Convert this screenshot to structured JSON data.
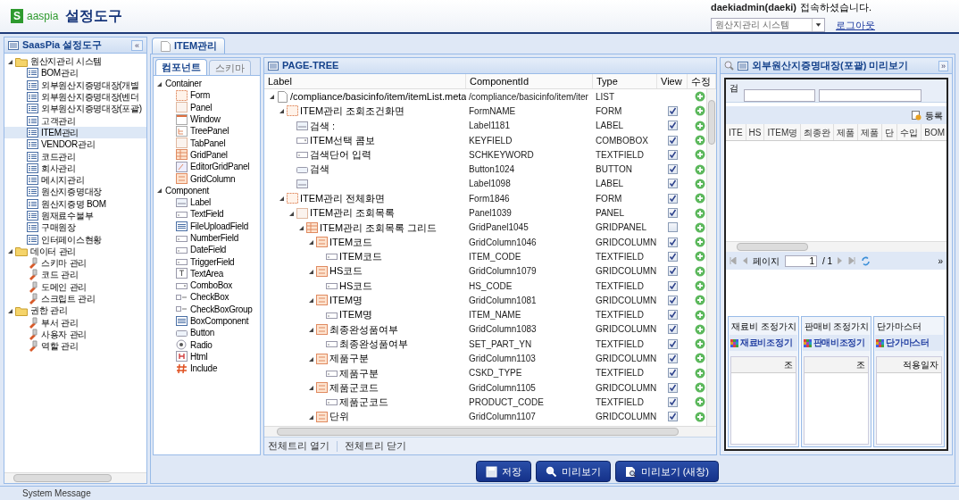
{
  "header": {
    "logo_mark": "S",
    "logo_text": "aaspia",
    "title": "설정도구",
    "user_name": "daekiadmin(daeki)",
    "user_suffix": "접속하셨습니다.",
    "system_select": "원산지관리 시스템",
    "logout": "로그아웃"
  },
  "sidebar": {
    "title": "SaasPia 설정도구",
    "collapse": "«",
    "tree": [
      {
        "label": "원산지관리 시스템",
        "kind": "folder",
        "expanded": true,
        "children": [
          {
            "label": "BOM관리",
            "kind": "page",
            "selected": false
          },
          {
            "label": "외부원산지증명대장(개별",
            "kind": "page",
            "selected": false
          },
          {
            "label": "외부원산지증명대장(벤더",
            "kind": "page",
            "selected": false
          },
          {
            "label": "외부원산지증명대장(포괄)",
            "kind": "page",
            "selected": false
          },
          {
            "label": "고객관리",
            "kind": "page",
            "selected": false
          },
          {
            "label": "ITEM관리",
            "kind": "page",
            "selected": true
          },
          {
            "label": "VENDOR관리",
            "kind": "page",
            "selected": false
          },
          {
            "label": "코드관리",
            "kind": "page",
            "selected": false
          },
          {
            "label": "회사관리",
            "kind": "page",
            "selected": false
          },
          {
            "label": "메시지관리",
            "kind": "page",
            "selected": false
          },
          {
            "label": "원산지증명대장",
            "kind": "page",
            "selected": false
          },
          {
            "label": "원산지증명 BOM",
            "kind": "page",
            "selected": false
          },
          {
            "label": "원재료수불부",
            "kind": "page",
            "selected": false
          },
          {
            "label": "구매원장",
            "kind": "page",
            "selected": false
          },
          {
            "label": "인터페이스현황",
            "kind": "page",
            "selected": false
          }
        ]
      },
      {
        "label": "데이터 관리",
        "kind": "folder",
        "expanded": true,
        "children": [
          {
            "label": "스키마 관리",
            "kind": "tool",
            "selected": false
          },
          {
            "label": "코드 관리",
            "kind": "tool",
            "selected": false
          },
          {
            "label": "도메인 관리",
            "kind": "tool",
            "selected": false
          },
          {
            "label": "스크립트 관리",
            "kind": "tool",
            "selected": false
          }
        ]
      },
      {
        "label": "권한 관리",
        "kind": "folder",
        "expanded": true,
        "children": [
          {
            "label": "부서 관리",
            "kind": "tool",
            "selected": false
          },
          {
            "label": "사용자 관리",
            "kind": "tool",
            "selected": false
          },
          {
            "label": "역할 관리",
            "kind": "tool",
            "selected": false
          }
        ]
      }
    ]
  },
  "tabs": [
    {
      "label": "ITEM관리",
      "selected": true
    }
  ],
  "palette": {
    "tabs": [
      {
        "label": "컴포넌트",
        "selected": true
      },
      {
        "label": "스키마",
        "selected": false
      }
    ],
    "groups": [
      {
        "label": "Container",
        "expanded": true,
        "children": [
          {
            "label": "Form",
            "kind": "form"
          },
          {
            "label": "Panel",
            "kind": "panel"
          },
          {
            "label": "Window",
            "kind": "window"
          },
          {
            "label": "TreePanel",
            "kind": "tree"
          },
          {
            "label": "TabPanel",
            "kind": "panel"
          },
          {
            "label": "GridPanel",
            "kind": "grid"
          },
          {
            "label": "EditorGridPanel",
            "kind": "editor"
          },
          {
            "label": "GridColumn",
            "kind": "column"
          }
        ]
      },
      {
        "label": "Component",
        "expanded": true,
        "children": [
          {
            "label": "Label",
            "kind": "label"
          },
          {
            "label": "TextField",
            "kind": "textfield"
          },
          {
            "label": "FileUploadField",
            "kind": "list"
          },
          {
            "label": "NumberField",
            "kind": "textfield"
          },
          {
            "label": "DateField",
            "kind": "textfield"
          },
          {
            "label": "TriggerField",
            "kind": "textfield"
          },
          {
            "label": "TextArea",
            "kind": "textarea"
          },
          {
            "label": "ComboBox",
            "kind": "combo"
          },
          {
            "label": "CheckBox",
            "kind": "checkbox"
          },
          {
            "label": "CheckBoxGroup",
            "kind": "checkbox"
          },
          {
            "label": "BoxComponent",
            "kind": "list"
          },
          {
            "label": "Button",
            "kind": "button"
          },
          {
            "label": "Radio",
            "kind": "radio"
          },
          {
            "label": "Html",
            "kind": "html"
          },
          {
            "label": "Include",
            "kind": "include"
          }
        ]
      }
    ]
  },
  "page_tree": {
    "title": "PAGE-TREE",
    "columns": [
      "Label",
      "ComponentId",
      "Type",
      "View",
      "수정"
    ],
    "rows": [
      {
        "label": "/compliance/basicinfo/item/itemList.meta",
        "component_id": "/compliance/basicinfo/item/iter",
        "type": "LIST",
        "kind": "file",
        "expanded": true,
        "children": [
          {
            "label": "ITEM관리 조회조건화면",
            "component_id": "FormNAME",
            "type": "FORM",
            "kind": "form",
            "view": true,
            "expanded": true,
            "children": [
              {
                "label": "검색 :",
                "component_id": "Label1181",
                "type": "LABEL",
                "kind": "label",
                "view": true
              },
              {
                "label": "ITEM선택 콤보",
                "component_id": "KEYFIELD",
                "type": "COMBOBOX",
                "kind": "combo",
                "view": true
              },
              {
                "label": "검색단어 입력",
                "component_id": "SCHKEYWORD",
                "type": "TEXTFIELD",
                "kind": "textfield",
                "view": true
              },
              {
                "label": "검색",
                "component_id": "Button1024",
                "type": "BUTTON",
                "kind": "button",
                "view": true
              },
              {
                "component_id": "Label1098",
                "type": "LABEL",
                "kind": "label",
                "view": true
              }
            ]
          },
          {
            "label": "ITEM관리 전체화면",
            "component_id": "Form1846",
            "type": "FORM",
            "kind": "form",
            "view": true,
            "expanded": true,
            "children": [
              {
                "label": "ITEM관리 조회목록",
                "component_id": "Panel1039",
                "type": "PANEL",
                "kind": "panel",
                "view": true,
                "expanded": true,
                "children": [
                  {
                    "label": "ITEM관리 조회목록 그리드",
                    "component_id": "GridPanel1045",
                    "type": "GRIDPANEL",
                    "kind": "grid",
                    "view": false,
                    "expanded": true,
                    "children": [
                      {
                        "label": "ITEM코드",
                        "component_id": "GridColumn1046",
                        "type": "GRIDCOLUMN",
                        "kind": "column",
                        "view": true,
                        "expanded": true,
                        "children": [
                          {
                            "label": "ITEM코드",
                            "component_id": "ITEM_CODE",
                            "type": "TEXTFIELD",
                            "kind": "textfield",
                            "view": true
                          }
                        ]
                      },
                      {
                        "label": "HS코드",
                        "component_id": "GridColumn1079",
                        "type": "GRIDCOLUMN",
                        "kind": "column",
                        "view": true,
                        "expanded": true,
                        "children": [
                          {
                            "label": "HS코드",
                            "component_id": "HS_CODE",
                            "type": "TEXTFIELD",
                            "kind": "textfield",
                            "view": true
                          }
                        ]
                      },
                      {
                        "label": "ITEM명",
                        "component_id": "GridColumn1081",
                        "type": "GRIDCOLUMN",
                        "kind": "column",
                        "view": true,
                        "expanded": true,
                        "children": [
                          {
                            "label": "ITEM명",
                            "component_id": "ITEM_NAME",
                            "type": "TEXTFIELD",
                            "kind": "textfield",
                            "view": true
                          }
                        ]
                      },
                      {
                        "label": "최종완성품여부",
                        "component_id": "GridColumn1083",
                        "type": "GRIDCOLUMN",
                        "kind": "column",
                        "view": true,
                        "expanded": true,
                        "children": [
                          {
                            "label": "최종완성품여부",
                            "component_id": "SET_PART_YN",
                            "type": "TEXTFIELD",
                            "kind": "textfield",
                            "view": true
                          }
                        ]
                      },
                      {
                        "label": "제품구분",
                        "component_id": "GridColumn1103",
                        "type": "GRIDCOLUMN",
                        "kind": "column",
                        "view": true,
                        "expanded": true,
                        "children": [
                          {
                            "label": "제품구분",
                            "component_id": "CSKD_TYPE",
                            "type": "TEXTFIELD",
                            "kind": "textfield",
                            "view": true
                          }
                        ]
                      },
                      {
                        "label": "제품군코드",
                        "component_id": "GridColumn1105",
                        "type": "GRIDCOLUMN",
                        "kind": "column",
                        "view": true,
                        "expanded": true,
                        "children": [
                          {
                            "label": "제품군코드",
                            "component_id": "PRODUCT_CODE",
                            "type": "TEXTFIELD",
                            "kind": "textfield",
                            "view": true
                          }
                        ]
                      },
                      {
                        "label": "단위",
                        "component_id": "GridColumn1107",
                        "type": "GRIDCOLUMN",
                        "kind": "column",
                        "view": true,
                        "expanded": true
                      }
                    ]
                  }
                ]
              }
            ]
          }
        ]
      }
    ],
    "footer_links": [
      "전체트리 열기",
      "전체트리 닫기"
    ]
  },
  "buttons": [
    {
      "label": "저장",
      "kind": "save"
    },
    {
      "label": "미리보기",
      "kind": "preview"
    },
    {
      "label": "미리보기 (새창)",
      "kind": "preview_new"
    }
  ],
  "preview": {
    "title": "외부원산지증명대장(포괄) 미리보기",
    "expand": "»",
    "search_label": "검",
    "add_button": "등록",
    "grid_columns": [
      "ITE",
      "HS",
      "ITEM명",
      "최종완",
      "제품",
      "제품",
      "단",
      "수입",
      "BOM"
    ],
    "paging": {
      "page_label": "페이지",
      "page": "1",
      "total": "/ 1",
      "more": "»"
    },
    "subpanels": [
      {
        "title": "재료비 조정가치",
        "button": "재료비조정기",
        "column": "조"
      },
      {
        "title": "판매비 조정가치",
        "button": "판매비조정기",
        "column": "조"
      },
      {
        "title": "단가마스터",
        "button": "단가마스터",
        "column": "적용일자"
      }
    ]
  },
  "status_bar": "System Message"
}
